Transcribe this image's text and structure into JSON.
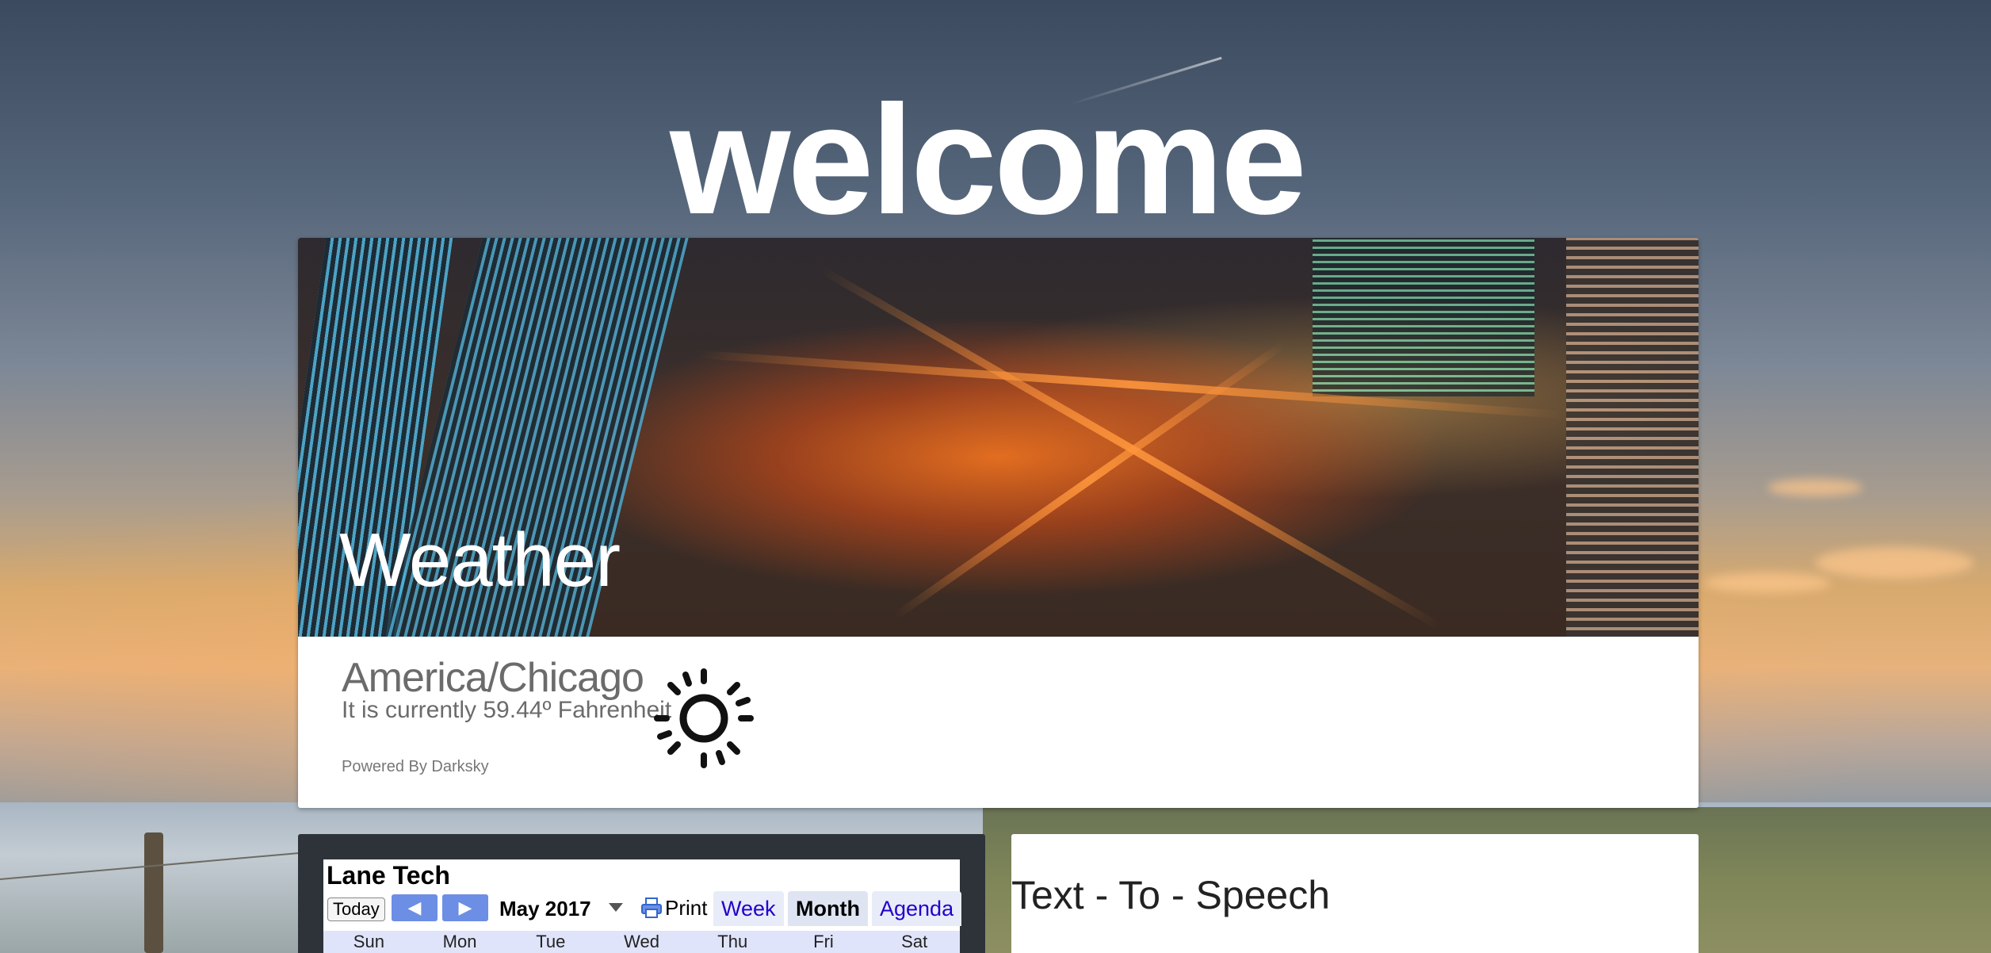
{
  "header": {
    "welcome_text": "welcome"
  },
  "weather": {
    "title": "Weather",
    "location": "America/Chicago",
    "current_text": "It is currently 59.44º Fahrenheit",
    "powered_by": "Powered By Darksky",
    "icon": "sun-icon"
  },
  "calendar": {
    "title": "Lane Tech",
    "today_label": "Today",
    "prev_icon": "chevron-left-icon",
    "next_icon": "chevron-right-icon",
    "month_label": "May 2017",
    "print_label": "Print",
    "tabs": [
      {
        "label": "Week",
        "active": false
      },
      {
        "label": "Month",
        "active": true
      },
      {
        "label": "Agenda",
        "active": false
      }
    ],
    "weekdays": [
      "Sun",
      "Mon",
      "Tue",
      "Wed",
      "Thu",
      "Fri",
      "Sat"
    ]
  },
  "tts": {
    "title": "Text - To - Speech"
  },
  "colors": {
    "nav_button": "#6c8ee4",
    "tab_link": "#2200cc",
    "calendar_panel": "#2d3339"
  }
}
